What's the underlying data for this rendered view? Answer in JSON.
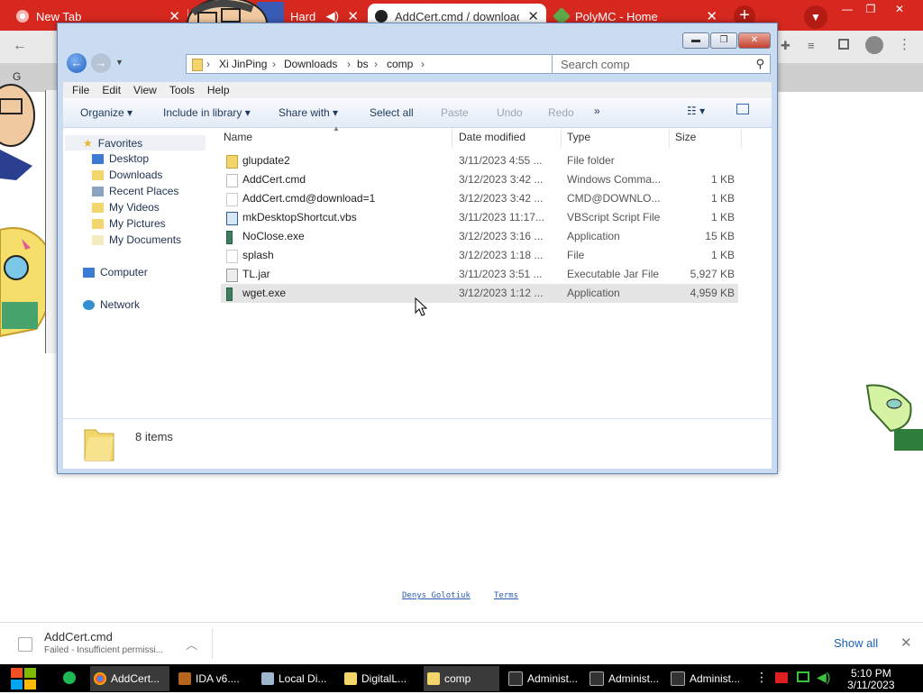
{
  "chrome": {
    "tabs": [
      {
        "title": "New Tab"
      },
      {
        "title": "Hard"
      },
      {
        "title": "AddCert.cmd / download"
      },
      {
        "title": "PolyMC - Home"
      }
    ],
    "page_fragment": "G"
  },
  "explorer": {
    "breadcrumb": [
      "Xi JinPing",
      "Downloads",
      "bs",
      "comp"
    ],
    "search_placeholder": "Search comp",
    "menu": [
      "File",
      "Edit",
      "View",
      "Tools",
      "Help"
    ],
    "commands": {
      "organize": "Organize",
      "include_library": "Include in library",
      "share_with": "Share with",
      "select_all": "Select all",
      "paste": "Paste",
      "undo": "Undo",
      "redo": "Redo",
      "more": "»"
    },
    "nav": {
      "favorites": "Favorites",
      "items": [
        "Desktop",
        "Downloads",
        "Recent Places",
        "My Videos",
        "My Pictures",
        "My Documents"
      ],
      "computer": "Computer",
      "network": "Network"
    },
    "columns": [
      "Name",
      "Date modified",
      "Type",
      "Size"
    ],
    "files": [
      {
        "name": "glupdate2",
        "date": "3/11/2023 4:55 ...",
        "type": "File folder",
        "size": "",
        "icon": "folder-icon"
      },
      {
        "name": "AddCert.cmd",
        "date": "3/12/2023 3:42 ...",
        "type": "Windows Comma...",
        "size": "1 KB",
        "icon": "cmd-file-icon"
      },
      {
        "name": "AddCert.cmd@download=1",
        "date": "3/12/2023 3:42 ...",
        "type": "CMD@DOWNLO...",
        "size": "1 KB",
        "icon": "file-icon"
      },
      {
        "name": "mkDesktopShortcut.vbs",
        "date": "3/11/2023 11:17...",
        "type": "VBScript Script File",
        "size": "1 KB",
        "icon": "vbs-file-icon"
      },
      {
        "name": "NoClose.exe",
        "date": "3/12/2023 3:16 ...",
        "type": "Application",
        "size": "15 KB",
        "icon": "exe-file-icon"
      },
      {
        "name": "splash",
        "date": "3/12/2023 1:18 ...",
        "type": "File",
        "size": "1 KB",
        "icon": "file-icon"
      },
      {
        "name": "TL.jar",
        "date": "3/11/2023 3:51 ...",
        "type": "Executable Jar File",
        "size": "5,927 KB",
        "icon": "jar-file-icon"
      },
      {
        "name": "wget.exe",
        "date": "3/12/2023 1:12 ...",
        "type": "Application",
        "size": "4,959 KB",
        "icon": "exe-file-icon"
      }
    ],
    "status": "8 items"
  },
  "page_footer": {
    "link1": "Denys Golotiuk",
    "link2": "Terms"
  },
  "download_shelf": {
    "filename": "AddCert.cmd",
    "status": "Failed - Insufficient permissi...",
    "show_all": "Show all"
  },
  "taskbar": {
    "items": [
      "AddCert...",
      "IDA v6....",
      "Local Di...",
      "DigitalL...",
      "comp",
      "Administ...",
      "Administ...",
      "Administ..."
    ],
    "time": "5:10 PM",
    "date": "3/11/2023"
  },
  "colors": {
    "chrome_red": "#d6281f",
    "link_blue": "#2a5db0",
    "taskbar": "#000000"
  }
}
